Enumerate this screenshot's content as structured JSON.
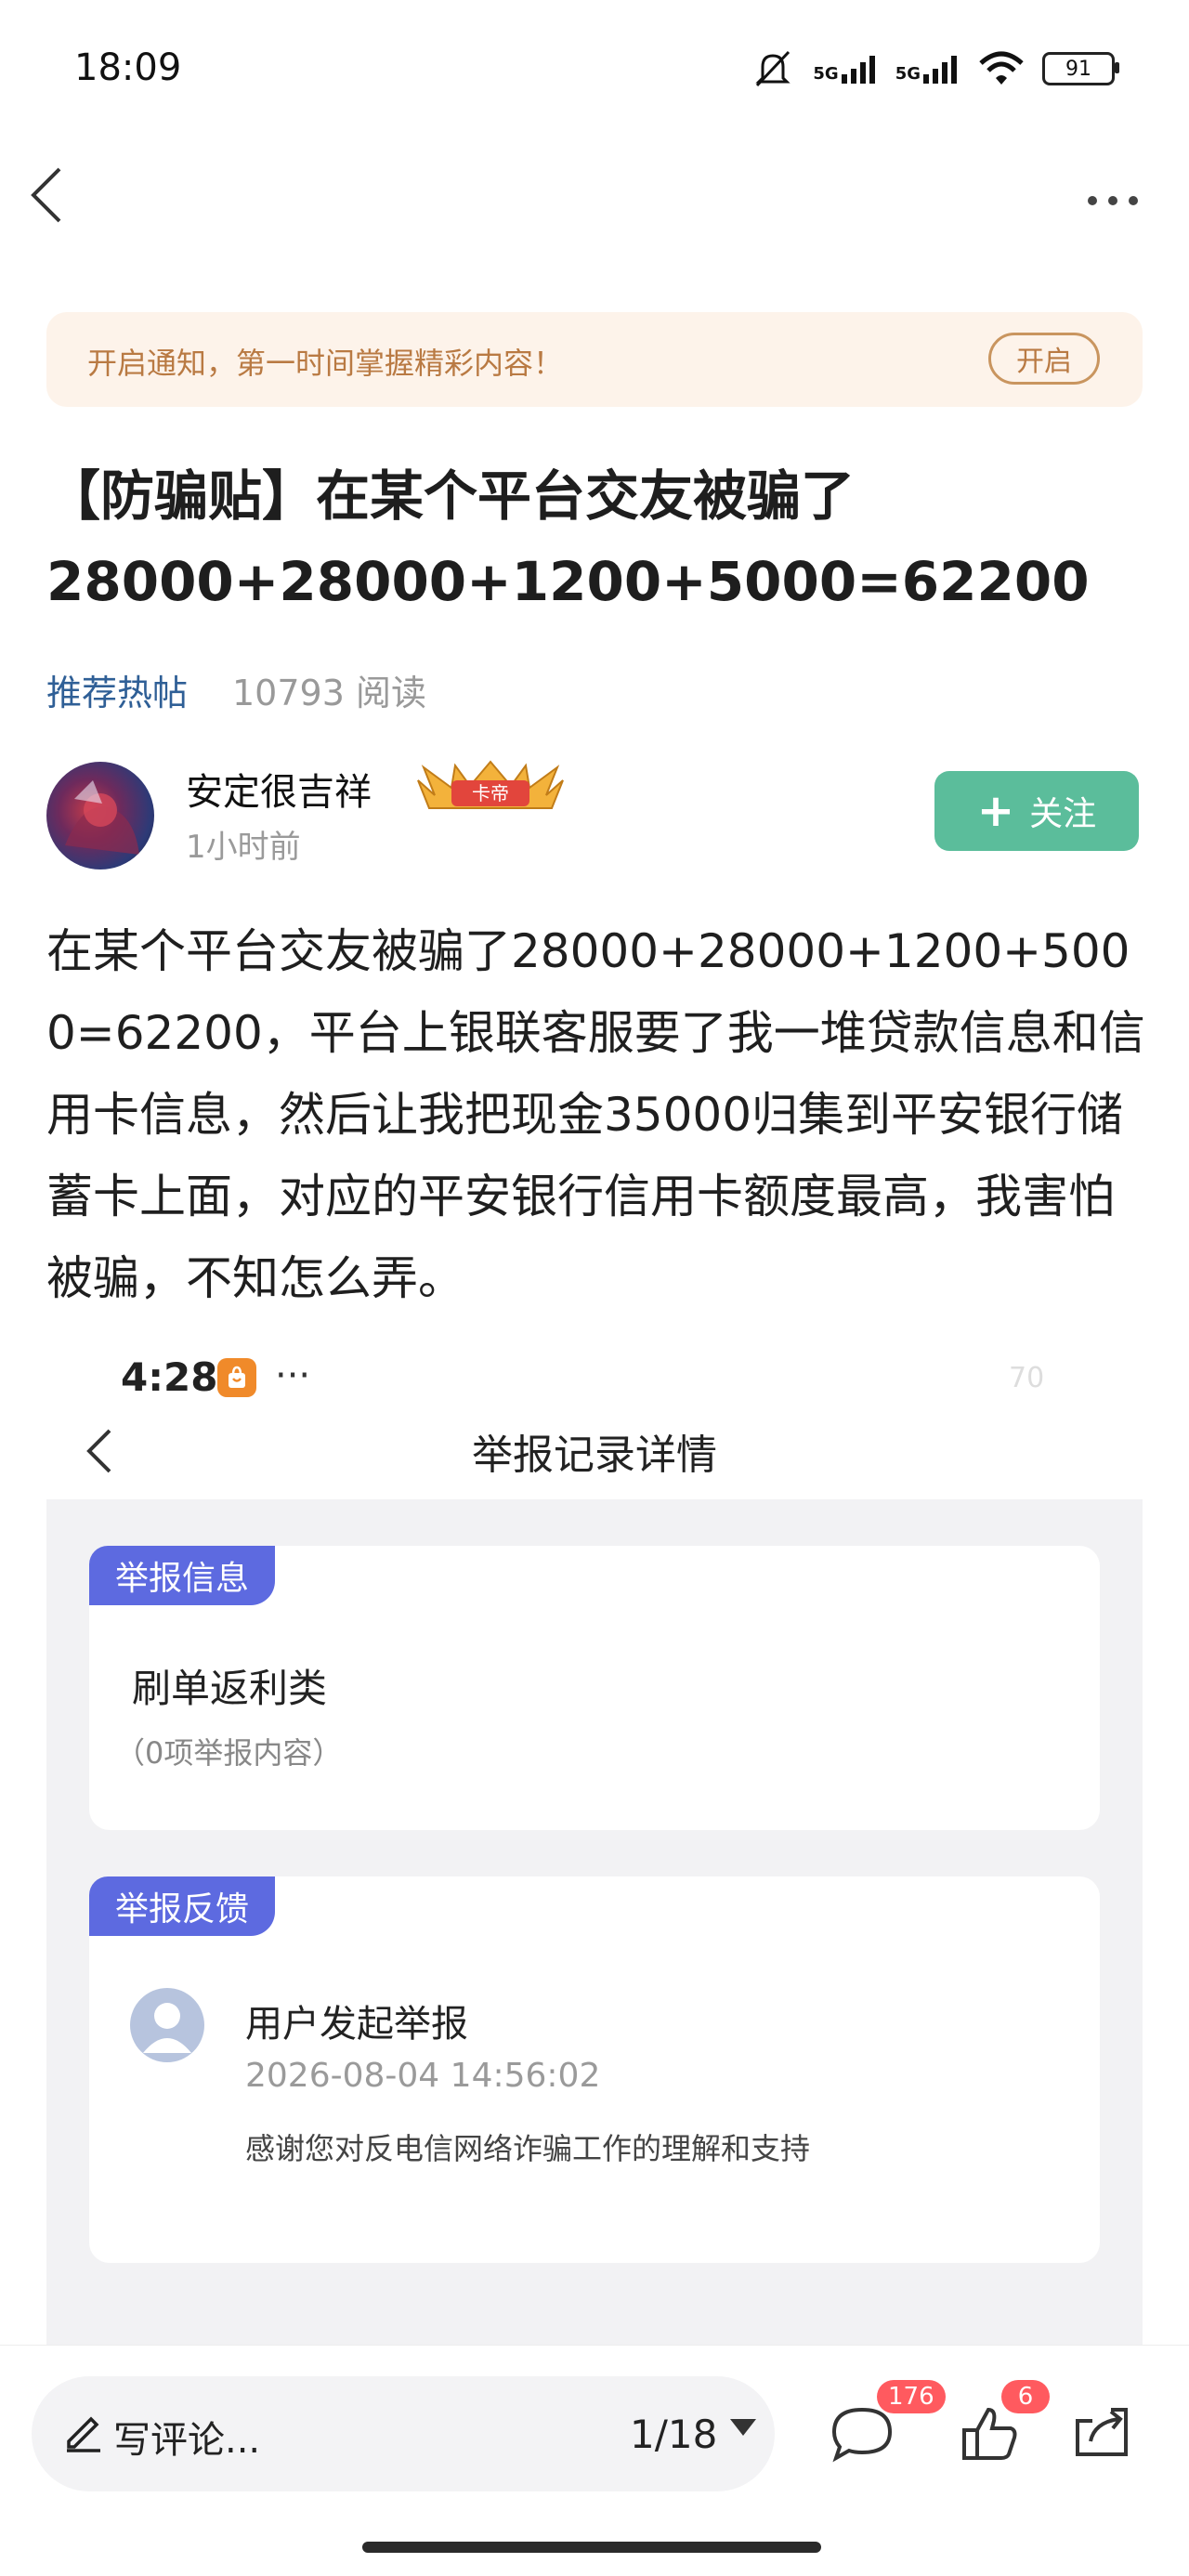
{
  "status_bar": {
    "time": "18:09",
    "signal_1": "5G",
    "signal_2": "5G",
    "battery": "91"
  },
  "notification": {
    "text": "开启通知，第一时间掌握精彩内容！",
    "button": "开启"
  },
  "post": {
    "title": "【防骗贴】在某个平台交友被骗了28000+28000+1200+5000=62200",
    "tag": "推荐热帖",
    "reads": "10793 阅读",
    "author": {
      "name": "安定很吉祥",
      "badge": "卡帝",
      "time": "1小时前",
      "follow_label": "关注"
    },
    "body": "在某个平台交友被骗了28000+28000+1200+5000=62200，平台上银联客服要了我一堆贷款信息和信用卡信息，然后让我把现金35000归集到平安银行储蓄卡上面，对应的平安银行信用卡额度最高，我害怕被骗，不知怎么弄。"
  },
  "screenshot": {
    "time": "4:28",
    "dots": "···",
    "battery": "70",
    "header": "举报记录详情",
    "card1": {
      "tag": "举报信息",
      "title": "刷单返利类",
      "subtitle": "（0项举报内容）"
    },
    "card2": {
      "tag": "举报反馈",
      "title": "用户发起举报",
      "datetime": "2026-08-04 14:56:02",
      "note": "感谢您对反电信网络诈骗工作的理解和支持"
    }
  },
  "bottom_bar": {
    "comment_placeholder": "写评论...",
    "page_indicator": "1/18",
    "comment_count": "176",
    "like_count": "6"
  },
  "colors": {
    "follow": "#5bbd9b",
    "tag_link": "#2f5f96",
    "report_tag": "#5d6ae0",
    "badge_red": "#ff5a5f",
    "notif_bg": "#fdf3ea"
  }
}
